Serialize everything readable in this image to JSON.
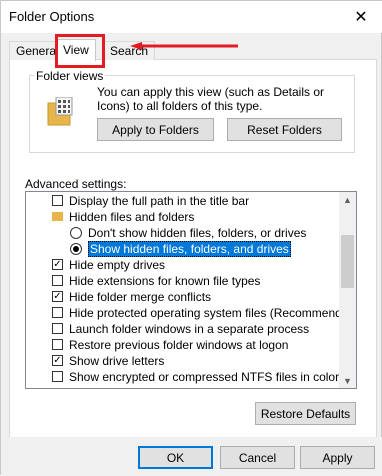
{
  "window": {
    "title": "Folder Options",
    "close_glyph": "✕"
  },
  "tabs": [
    {
      "label": "General"
    },
    {
      "label": "View"
    },
    {
      "label": "Search"
    }
  ],
  "folder_views": {
    "title": "Folder views",
    "description": "You can apply this view (such as Details or Icons) to all folders of this type.",
    "apply_button": "Apply to Folders",
    "reset_button": "Reset Folders"
  },
  "advanced": {
    "label": "Advanced settings:",
    "items": [
      {
        "type": "checkbox",
        "checked": false,
        "label": "Display the full path in the title bar"
      },
      {
        "type": "folder",
        "label": "Hidden files and folders"
      },
      {
        "type": "radio",
        "checked": false,
        "label": "Don't show hidden files, folders, or drives"
      },
      {
        "type": "radio",
        "checked": true,
        "label": "Show hidden files, folders, and drives"
      },
      {
        "type": "checkbox",
        "checked": true,
        "label": "Hide empty drives"
      },
      {
        "type": "checkbox",
        "checked": false,
        "label": "Hide extensions for known file types"
      },
      {
        "type": "checkbox",
        "checked": true,
        "label": "Hide folder merge conflicts"
      },
      {
        "type": "checkbox",
        "checked": false,
        "label": "Hide protected operating system files (Recommended)"
      },
      {
        "type": "checkbox",
        "checked": false,
        "label": "Launch folder windows in a separate process"
      },
      {
        "type": "checkbox",
        "checked": false,
        "label": "Restore previous folder windows at logon"
      },
      {
        "type": "checkbox",
        "checked": true,
        "label": "Show drive letters"
      },
      {
        "type": "checkbox",
        "checked": false,
        "label": "Show encrypted or compressed NTFS files in color"
      }
    ]
  },
  "restore_defaults": "Restore Defaults",
  "footer": {
    "ok": "OK",
    "cancel": "Cancel",
    "apply": "Apply"
  },
  "colors": {
    "highlight": "#e31b23",
    "selection": "#0078d7",
    "focus_border": "#0078d7"
  }
}
